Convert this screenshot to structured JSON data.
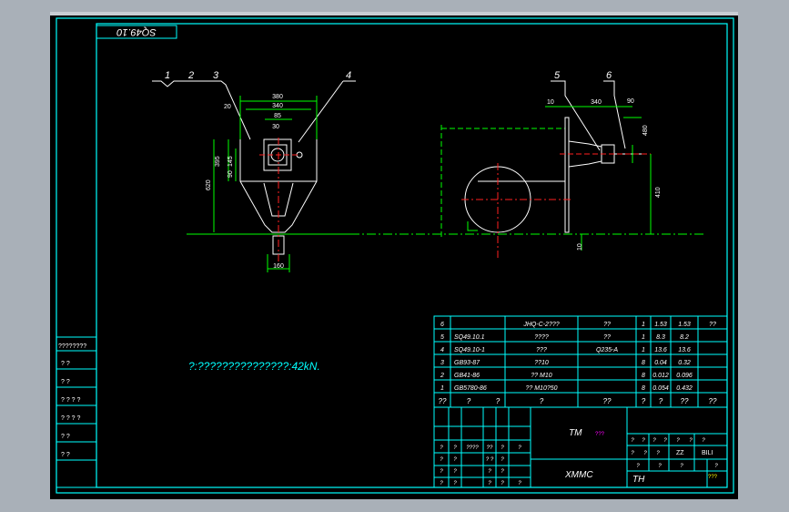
{
  "drawing_number": "SQ49.10",
  "note": "?:???????????????:42kN.",
  "colors": {
    "background": "#000000",
    "frame": "#00ffff",
    "dimension": "#00ff00",
    "outline": "#ffffff",
    "centerline": "#ff2020",
    "viewport_border": "#a9b0b8"
  },
  "left_view": {
    "balloons": [
      "1",
      "2",
      "3",
      "4"
    ],
    "dimensions": [
      "380",
      "340",
      "85",
      "30",
      "20",
      "395",
      "145",
      "90",
      "620",
      "160"
    ]
  },
  "right_view": {
    "balloons": [
      "5",
      "6"
    ],
    "dimensions": [
      "10",
      "340",
      "90",
      "480",
      "410",
      "10"
    ]
  },
  "bom": {
    "rows": [
      {
        "no": "6",
        "code": "",
        "name": "JHQ-C-2???",
        "material": "??",
        "qty": "1",
        "unit_w": "1.53",
        "total_w": "1.53",
        "remark": "??"
      },
      {
        "no": "5",
        "code": "SQ49.10.1",
        "name": "????",
        "material": "??",
        "qty": "1",
        "unit_w": "8.3",
        "total_w": "8.2",
        "remark": ""
      },
      {
        "no": "4",
        "code": "SQ49.10-1",
        "name": "???",
        "material": "Q235-A",
        "qty": "1",
        "unit_w": "13.6",
        "total_w": "13.6",
        "remark": ""
      },
      {
        "no": "3",
        "code": "GB93-87",
        "name": "??10",
        "material": "",
        "qty": "8",
        "unit_w": "0.04",
        "total_w": "0.32",
        "remark": ""
      },
      {
        "no": "2",
        "code": "GB41-86",
        "name": "?? M10",
        "material": "",
        "qty": "8",
        "unit_w": "0.012",
        "total_w": "0.096",
        "remark": ""
      },
      {
        "no": "1",
        "code": "GB5780-86",
        "name": "?? M10?50",
        "material": "",
        "qty": "8",
        "unit_w": "0.054",
        "total_w": "0.432",
        "remark": ""
      }
    ],
    "header": [
      "??",
      "?",
      "?",
      "?",
      "??",
      "?",
      "?",
      "??",
      "??"
    ]
  },
  "title_block": {
    "mid_title_a": "TM",
    "mid_title_b": "???",
    "org": "XMMC",
    "th_label": "TH",
    "zz_label": "ZZ",
    "bili_label": "BILI",
    "stamp": "???",
    "left_rows": [
      [
        "?",
        "?",
        "????",
        "??",
        "?",
        "?"
      ],
      [
        "?",
        "?",
        "",
        "? ?",
        "?",
        ""
      ],
      [
        "?",
        "?",
        "",
        "?",
        "?",
        ""
      ],
      [
        "?",
        "?",
        "",
        "?",
        "?",
        "?"
      ]
    ],
    "right_rows": [
      [
        "?",
        "?",
        "?",
        "?",
        "?",
        "?",
        "?"
      ],
      [
        "?",
        "?",
        "?",
        "",
        "ZZ",
        "BILI"
      ],
      [
        "?",
        "?",
        "?",
        "?"
      ]
    ]
  },
  "sidebar": [
    "????????",
    "?   ?",
    "?   ?",
    "? ? ? ?",
    "? ? ? ?",
    "?   ?",
    "?   ?"
  ]
}
